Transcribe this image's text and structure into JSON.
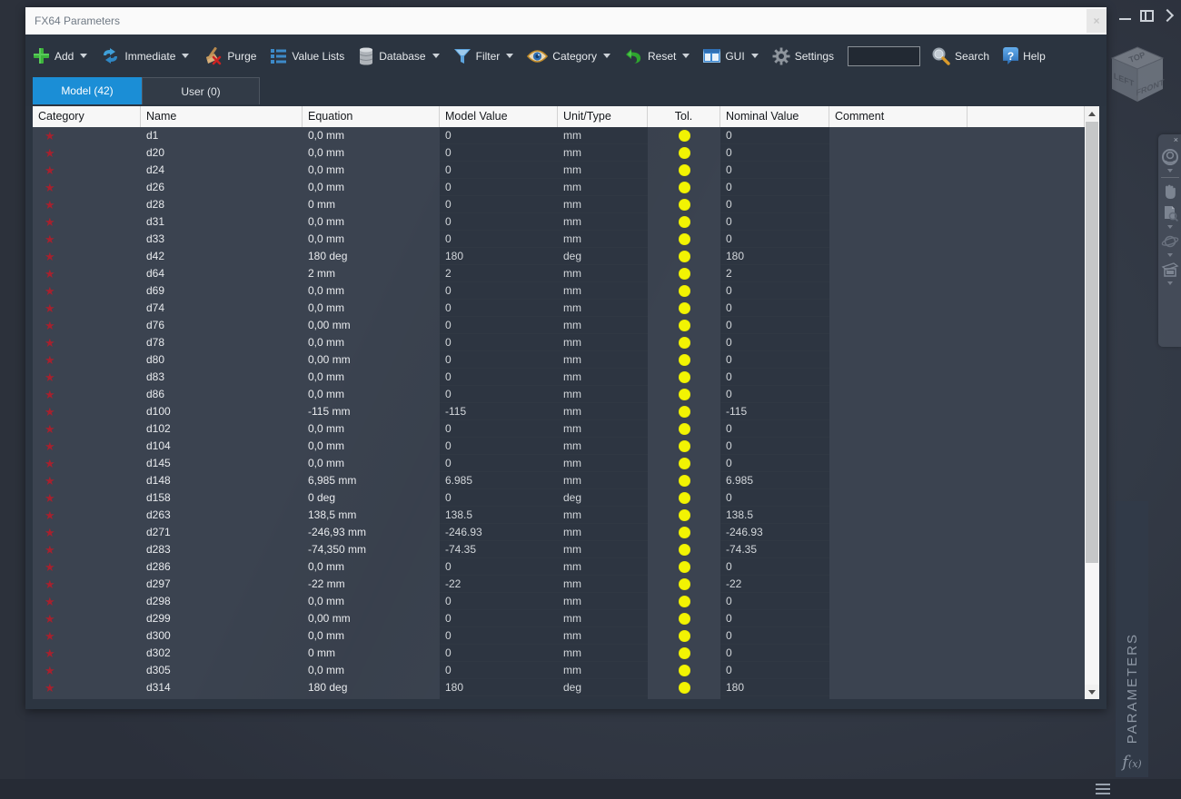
{
  "window": {
    "title": "FX64 Parameters",
    "close_label": "×",
    "controls": [
      "minimize",
      "layout",
      "expand"
    ]
  },
  "toolbar": {
    "items": [
      {
        "label": "Add",
        "dropdown": true,
        "icon": "plus-icon"
      },
      {
        "label": "Immediate",
        "dropdown": true,
        "icon": "swap-arrows-icon"
      },
      {
        "label": "Purge",
        "dropdown": false,
        "icon": "broom-icon"
      },
      {
        "label": "Value Lists",
        "dropdown": false,
        "icon": "list-icon"
      },
      {
        "label": "Database",
        "dropdown": true,
        "icon": "database-icon"
      },
      {
        "label": "Filter",
        "dropdown": true,
        "icon": "funnel-icon"
      },
      {
        "label": "Category",
        "dropdown": true,
        "icon": "eye-icon"
      },
      {
        "label": "Reset",
        "dropdown": true,
        "icon": "undo-arrow-icon"
      },
      {
        "label": "GUI",
        "dropdown": true,
        "icon": "window-icon"
      },
      {
        "label": "Settings",
        "dropdown": false,
        "icon": "gear-icon"
      },
      {
        "label": "Search",
        "dropdown": false,
        "icon": "magnifier-icon"
      },
      {
        "label": "Help",
        "dropdown": false,
        "icon": "help-icon"
      }
    ],
    "search_input_value": ""
  },
  "tabs": [
    {
      "label": "Model (42)",
      "active": true
    },
    {
      "label": "User (0)",
      "active": false
    }
  ],
  "table": {
    "columns": [
      "Category",
      "Name",
      "Equation",
      "Model Value",
      "Unit/Type",
      "Tol.",
      "Nominal Value",
      "Comment"
    ],
    "rows": [
      {
        "name": "d1",
        "equation": "0,0 mm",
        "model_value": "0",
        "unit": "mm",
        "tol": "yellow",
        "nominal_value": "0",
        "comment": ""
      },
      {
        "name": "d20",
        "equation": "0,0 mm",
        "model_value": "0",
        "unit": "mm",
        "tol": "yellow",
        "nominal_value": "0",
        "comment": ""
      },
      {
        "name": "d24",
        "equation": "0,0 mm",
        "model_value": "0",
        "unit": "mm",
        "tol": "yellow",
        "nominal_value": "0",
        "comment": ""
      },
      {
        "name": "d26",
        "equation": "0,0 mm",
        "model_value": "0",
        "unit": "mm",
        "tol": "yellow",
        "nominal_value": "0",
        "comment": ""
      },
      {
        "name": "d28",
        "equation": "0 mm",
        "model_value": "0",
        "unit": "mm",
        "tol": "yellow",
        "nominal_value": "0",
        "comment": ""
      },
      {
        "name": "d31",
        "equation": "0,0 mm",
        "model_value": "0",
        "unit": "mm",
        "tol": "yellow",
        "nominal_value": "0",
        "comment": ""
      },
      {
        "name": "d33",
        "equation": "0,0 mm",
        "model_value": "0",
        "unit": "mm",
        "tol": "yellow",
        "nominal_value": "0",
        "comment": ""
      },
      {
        "name": "d42",
        "equation": "180 deg",
        "model_value": "180",
        "unit": "deg",
        "tol": "yellow",
        "nominal_value": "180",
        "comment": ""
      },
      {
        "name": "d64",
        "equation": "2 mm",
        "model_value": "2",
        "unit": "mm",
        "tol": "yellow",
        "nominal_value": "2",
        "comment": ""
      },
      {
        "name": "d69",
        "equation": "0,0 mm",
        "model_value": "0",
        "unit": "mm",
        "tol": "yellow",
        "nominal_value": "0",
        "comment": ""
      },
      {
        "name": "d74",
        "equation": "0,0 mm",
        "model_value": "0",
        "unit": "mm",
        "tol": "yellow",
        "nominal_value": "0",
        "comment": ""
      },
      {
        "name": "d76",
        "equation": "0,00 mm",
        "model_value": "0",
        "unit": "mm",
        "tol": "yellow",
        "nominal_value": "0",
        "comment": ""
      },
      {
        "name": "d78",
        "equation": "0,0 mm",
        "model_value": "0",
        "unit": "mm",
        "tol": "yellow",
        "nominal_value": "0",
        "comment": ""
      },
      {
        "name": "d80",
        "equation": "0,00 mm",
        "model_value": "0",
        "unit": "mm",
        "tol": "yellow",
        "nominal_value": "0",
        "comment": ""
      },
      {
        "name": "d83",
        "equation": "0,0 mm",
        "model_value": "0",
        "unit": "mm",
        "tol": "yellow",
        "nominal_value": "0",
        "comment": ""
      },
      {
        "name": "d86",
        "equation": "0,0 mm",
        "model_value": "0",
        "unit": "mm",
        "tol": "yellow",
        "nominal_value": "0",
        "comment": ""
      },
      {
        "name": "d100",
        "equation": "-115 mm",
        "model_value": "-115",
        "unit": "mm",
        "tol": "yellow",
        "nominal_value": "-115",
        "comment": ""
      },
      {
        "name": "d102",
        "equation": "0,0 mm",
        "model_value": "0",
        "unit": "mm",
        "tol": "yellow",
        "nominal_value": "0",
        "comment": ""
      },
      {
        "name": "d104",
        "equation": "0,0 mm",
        "model_value": "0",
        "unit": "mm",
        "tol": "yellow",
        "nominal_value": "0",
        "comment": ""
      },
      {
        "name": "d145",
        "equation": "0,0 mm",
        "model_value": "0",
        "unit": "mm",
        "tol": "yellow",
        "nominal_value": "0",
        "comment": ""
      },
      {
        "name": "d148",
        "equation": "6,985 mm",
        "model_value": "6.985",
        "unit": "mm",
        "tol": "yellow",
        "nominal_value": "6.985",
        "comment": ""
      },
      {
        "name": "d158",
        "equation": "0 deg",
        "model_value": "0",
        "unit": "deg",
        "tol": "yellow",
        "nominal_value": "0",
        "comment": ""
      },
      {
        "name": "d263",
        "equation": "138,5 mm",
        "model_value": "138.5",
        "unit": "mm",
        "tol": "yellow",
        "nominal_value": "138.5",
        "comment": ""
      },
      {
        "name": "d271",
        "equation": "-246,93 mm",
        "model_value": "-246.93",
        "unit": "mm",
        "tol": "yellow",
        "nominal_value": "-246.93",
        "comment": ""
      },
      {
        "name": "d283",
        "equation": "-74,350 mm",
        "model_value": "-74.35",
        "unit": "mm",
        "tol": "yellow",
        "nominal_value": "-74.35",
        "comment": ""
      },
      {
        "name": "d286",
        "equation": "0,0 mm",
        "model_value": "0",
        "unit": "mm",
        "tol": "yellow",
        "nominal_value": "0",
        "comment": ""
      },
      {
        "name": "d297",
        "equation": "-22 mm",
        "model_value": "-22",
        "unit": "mm",
        "tol": "yellow",
        "nominal_value": "-22",
        "comment": ""
      },
      {
        "name": "d298",
        "equation": "0,0 mm",
        "model_value": "0",
        "unit": "mm",
        "tol": "yellow",
        "nominal_value": "0",
        "comment": ""
      },
      {
        "name": "d299",
        "equation": "0,00 mm",
        "model_value": "0",
        "unit": "mm",
        "tol": "yellow",
        "nominal_value": "0",
        "comment": ""
      },
      {
        "name": "d300",
        "equation": "0,0 mm",
        "model_value": "0",
        "unit": "mm",
        "tol": "yellow",
        "nominal_value": "0",
        "comment": ""
      },
      {
        "name": "d302",
        "equation": "0 mm",
        "model_value": "0",
        "unit": "mm",
        "tol": "yellow",
        "nominal_value": "0",
        "comment": ""
      },
      {
        "name": "d305",
        "equation": "0,0 mm",
        "model_value": "0",
        "unit": "mm",
        "tol": "yellow",
        "nominal_value": "0",
        "comment": ""
      },
      {
        "name": "d314",
        "equation": "180 deg",
        "model_value": "180",
        "unit": "deg",
        "tol": "yellow",
        "nominal_value": "180",
        "comment": ""
      }
    ],
    "partial_row_visible": true
  },
  "viewcube": {
    "top": "TOP",
    "left": "LEFT",
    "front": "FRONT"
  },
  "nav_bar": {
    "icons": [
      "full-navigation-wheel-icon",
      "pan-hand-icon",
      "zoom-page-icon",
      "orbit-icon",
      "look-at-icon"
    ],
    "close_label": "×"
  },
  "side_tab": {
    "label": "PARAMETERS",
    "fx_label": "f",
    "fx_sub": "(x)"
  },
  "colors": {
    "accent_blue": "#1b8ed6",
    "toolbar_bg": "#2b3440",
    "row_bg": "#3b4350",
    "value_column_bg": "#2d3541",
    "star_red": "#a6212e",
    "tol_yellow": "#f2f303",
    "header_bg": "#f7f7f7"
  }
}
